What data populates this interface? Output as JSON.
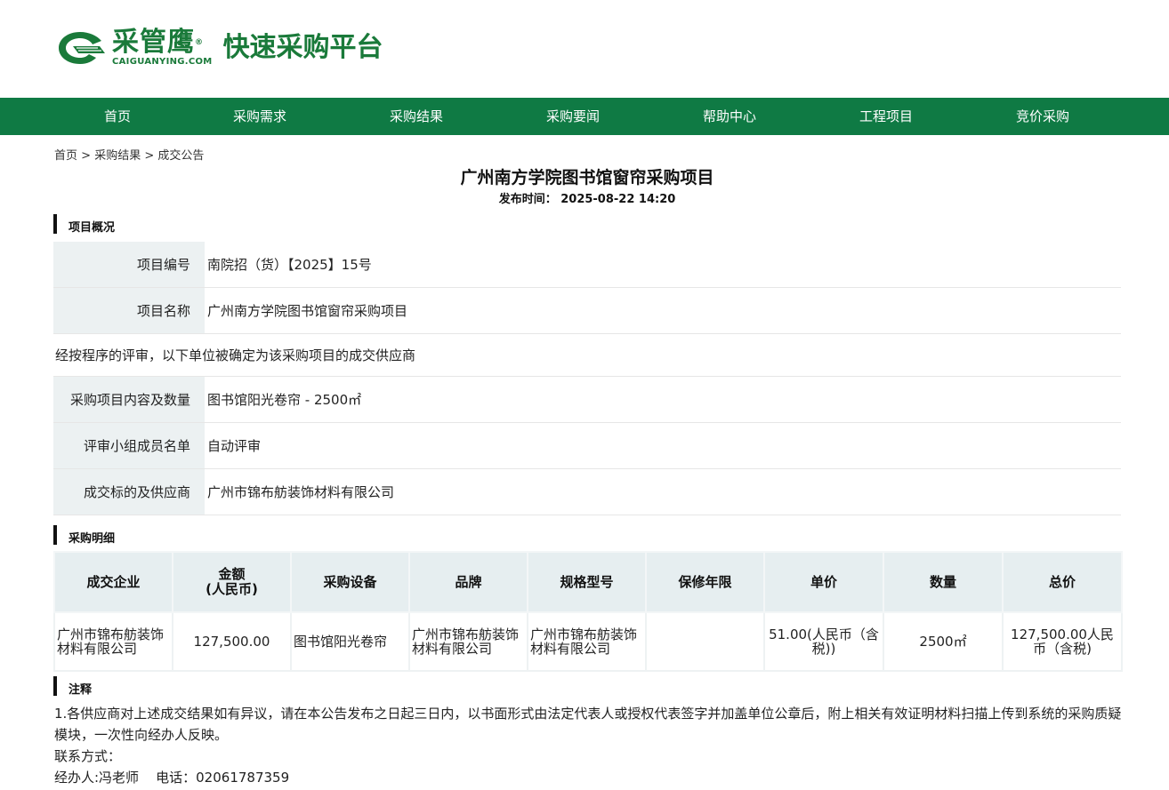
{
  "header": {
    "brand_cn": "采管鹰",
    "registered": "®",
    "brand_en": "CAIGUANYING.COM",
    "platform": "快速采购平台",
    "brand_color": "#1a7a3a"
  },
  "nav": {
    "color": "#0f7a44",
    "items": [
      "首页",
      "采购需求",
      "采购结果",
      "采购要闻",
      "帮助中心",
      "工程项目",
      "竞价采购"
    ]
  },
  "breadcrumb": {
    "home": "首页",
    "sep": ">",
    "level1": "采购结果",
    "level2": "成交公告"
  },
  "page": {
    "title": "广州南方学院图书馆窗帘采购项目",
    "pub_label": "发布时间：",
    "pub_time": "2025-08-22 14:20"
  },
  "overview": {
    "heading": "项目概况",
    "project_no_label": "项目编号",
    "project_no": "南院招（货）【2025】15号",
    "project_name_label": "项目名称",
    "project_name": "广州南方学院图书馆窗帘采购项目",
    "statement": "经按程序的评审，以下单位被确定为该采购项目的成交供应商",
    "content_label": "采购项目内容及数量",
    "content": "图书馆阳光卷帘 - 2500㎡",
    "panel_label": "评审小组成员名单",
    "panel": "自动评审",
    "winner_label": "成交标的及供应商",
    "winner": "广州市锦布舫装饰材料有限公司"
  },
  "details": {
    "heading": "采购明细",
    "columns": [
      "成交企业",
      "金额\n(人民币)",
      "采购设备",
      "品牌",
      "规格型号",
      "保修年限",
      "单价",
      "数量",
      "总价"
    ],
    "rows": [
      [
        "广州市锦布舫装饰材料有限公司",
        "127,500.00",
        "图书馆阳光卷帘",
        "广州市锦布舫装饰材料有限公司",
        "广州市锦布舫装饰材料有限公司",
        "",
        "51.00(人民币（含税))",
        "2500㎡",
        "127,500.00人民币（含税)"
      ]
    ]
  },
  "notes": {
    "heading": "注释",
    "line1": "1.各供应商对上述成交结果如有异议，请在本公告发布之日起三日内，以书面形式由法定代表人或授权代表签字并加盖单位公章后，附上相关有效证明材料扫描上传到系统的采购质疑模块，一次性向经办人反映。",
    "contact_label": "联系方式：",
    "agent": "经办人:冯老师",
    "phone": "电话：02061787359"
  }
}
